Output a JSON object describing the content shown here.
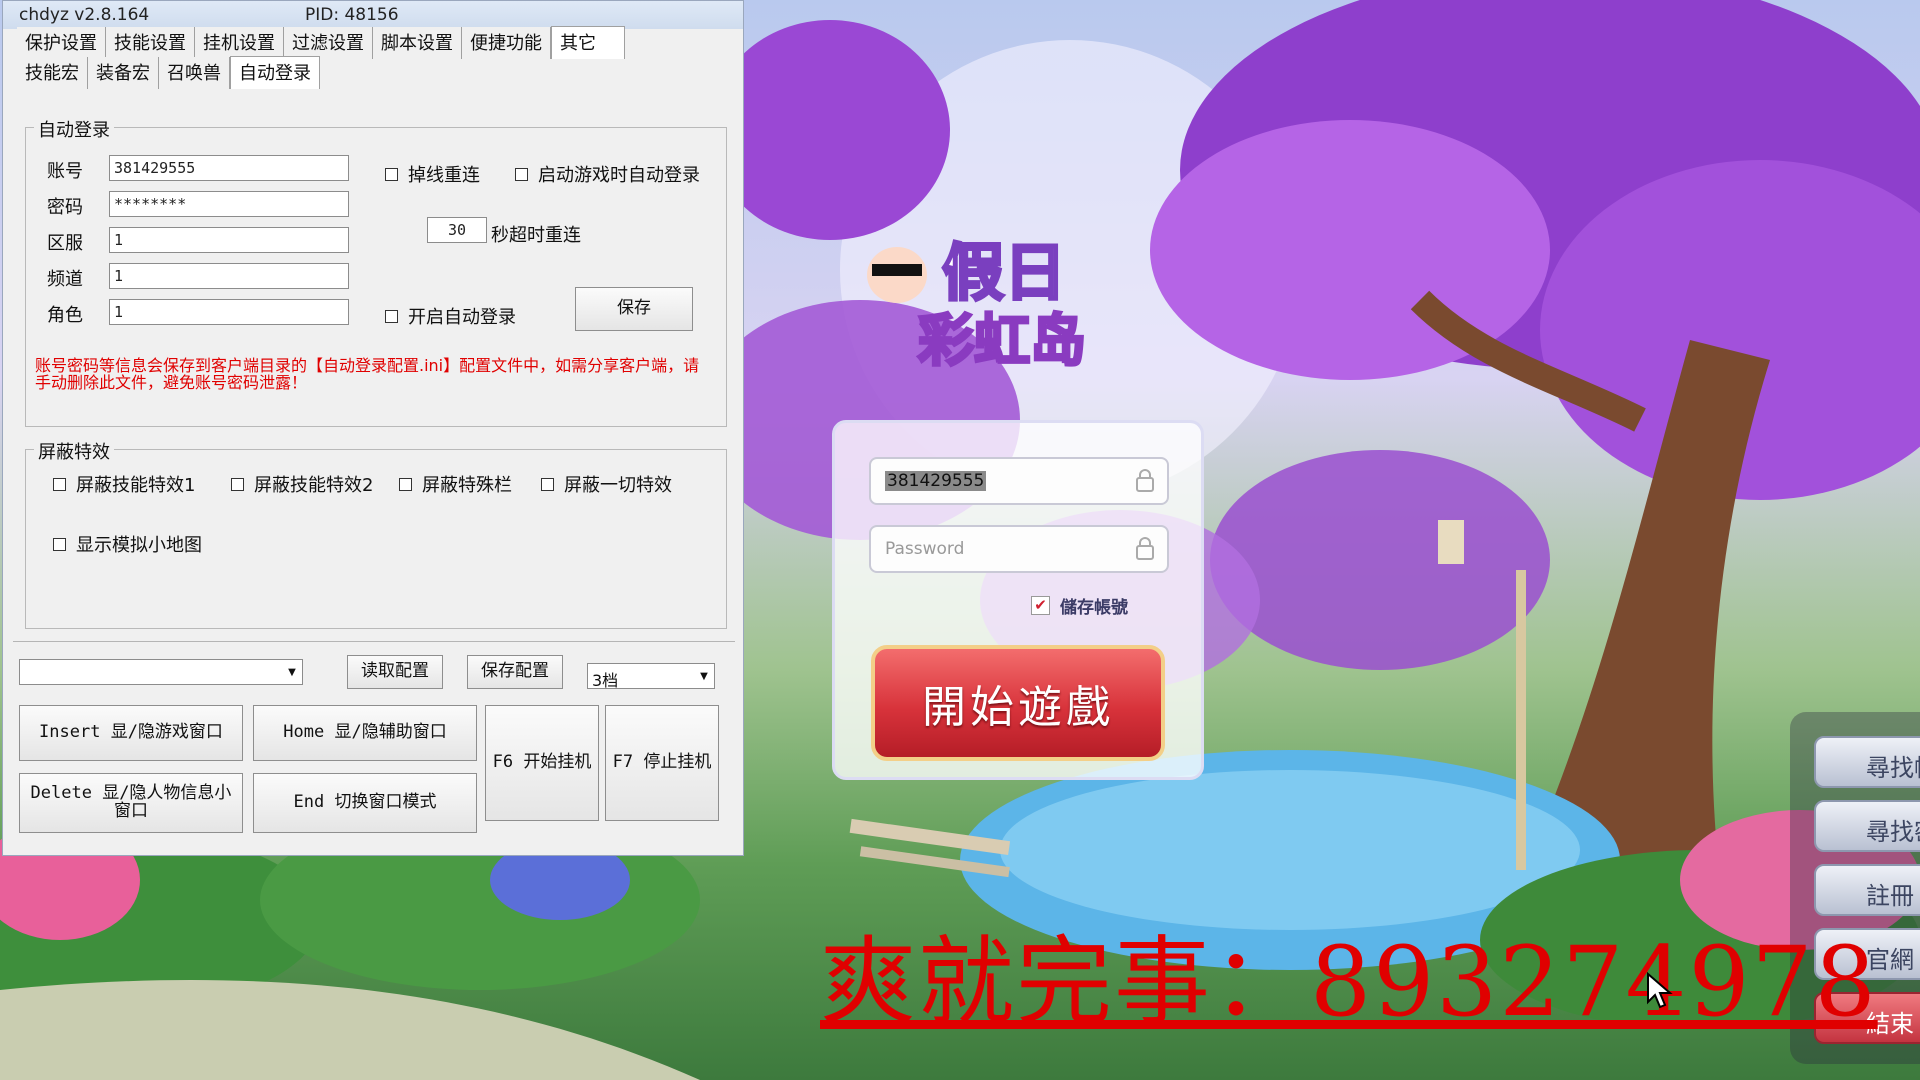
{
  "helper": {
    "title": "chdyz v2.8.164",
    "pid": "PID: 48156",
    "main_tabs": [
      "保护设置",
      "技能设置",
      "挂机设置",
      "过滤设置",
      "脚本设置",
      "便捷功能",
      "其它"
    ],
    "sub_tabs": [
      "技能宏",
      "装备宏",
      "召唤兽",
      "自动登录"
    ],
    "autologin": {
      "legend": "自动登录",
      "fields": [
        {
          "label": "账号",
          "value": "381429555"
        },
        {
          "label": "密码",
          "value": "********"
        },
        {
          "label": "区服",
          "value": "1"
        },
        {
          "label": "频道",
          "value": "1"
        },
        {
          "label": "角色",
          "value": "1"
        }
      ],
      "reconnect_label": "掉线重连",
      "auto_on_start_label": "启动游戏时自动登录",
      "timeout_value": "30",
      "timeout_label": "秒超时重连",
      "enable_label": "开启自动登录",
      "save_label": "保存",
      "warning": "账号密码等信息会保存到客户端目录的【自动登录配置.ini】配置文件中，如需分享客户端，请手动删除此文件，避免账号密码泄露！"
    },
    "effects": {
      "legend": "屏蔽特效",
      "items": [
        "屏蔽技能特效1",
        "屏蔽技能特效2",
        "屏蔽特殊栏",
        "屏蔽一切特效"
      ],
      "minimap_label": "显示模拟小地图"
    },
    "bottom": {
      "config_select": "",
      "read_config": "读取配置",
      "save_config": "保存配置",
      "level_select": "3档",
      "insert_btn": "Insert 显/隐游戏窗口",
      "home_btn": "Home 显/隐辅助窗口",
      "f6_btn": "F6 开始挂机",
      "f7_btn": "F7 停止挂机",
      "delete_btn": "Delete 显/隐人物信息小窗口",
      "end_btn": "End 切换窗口模式"
    }
  },
  "game": {
    "logo_line1": "假日",
    "logo_line2": "彩虹岛",
    "account_value": "381429555",
    "password_placeholder": "Password",
    "remember_label": "儲存帳號",
    "start_label": "開始遊戲",
    "side_buttons": [
      "尋找帳",
      "尋找密",
      "註冊",
      "官網",
      "結束"
    ]
  },
  "overlay": {
    "watermark": "爽就完事：893274978"
  },
  "colors": {
    "warning": "#e00000",
    "start_button": "#d8333b",
    "watermark": "#e00000"
  }
}
